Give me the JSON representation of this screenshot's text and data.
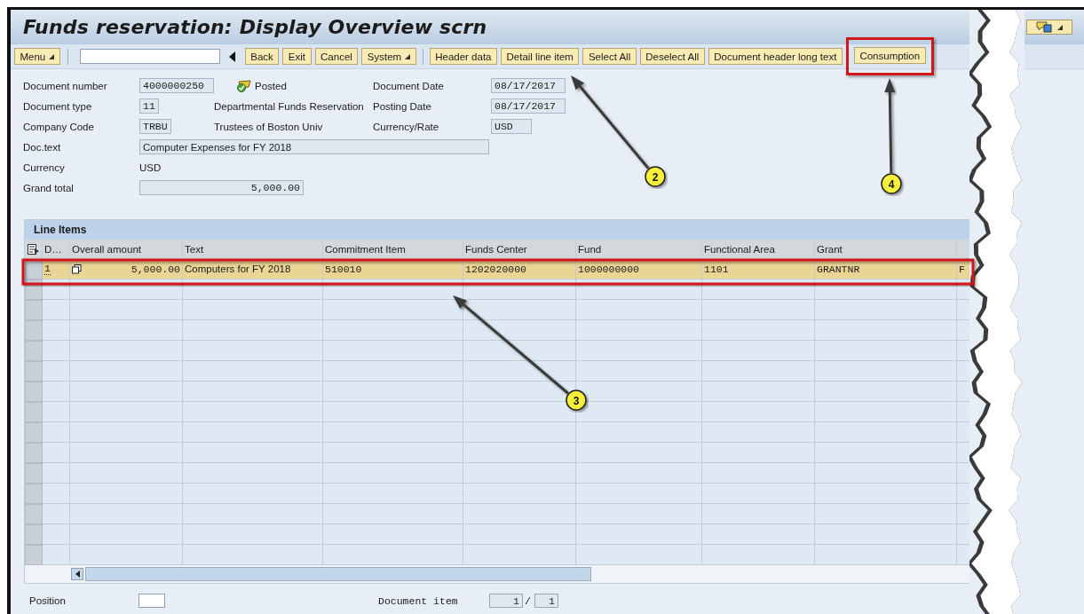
{
  "window": {
    "title": "Funds reservation: Display Overview scrn"
  },
  "toolbar": {
    "buttons": [
      {
        "label": "Menu",
        "kind": "dropdown",
        "highlighted": false
      },
      {
        "kind": "field"
      },
      {
        "kind": "back"
      },
      {
        "label": "Back",
        "kind": "button",
        "highlighted": false
      },
      {
        "label": "Exit",
        "kind": "button",
        "highlighted": false
      },
      {
        "label": "Cancel",
        "kind": "button",
        "highlighted": false
      },
      {
        "label": "System",
        "kind": "dropdown",
        "highlighted": false
      },
      {
        "kind": "separator"
      },
      {
        "label": "Header data",
        "kind": "button",
        "highlighted": false
      },
      {
        "label": "Detail line item",
        "kind": "button",
        "highlighted": false
      },
      {
        "label": "Select All",
        "kind": "button",
        "highlighted": false
      },
      {
        "label": "Deselect All",
        "kind": "button",
        "highlighted": false
      },
      {
        "label": "Document header long text",
        "kind": "button",
        "highlighted": false
      },
      {
        "label": "Consumption",
        "kind": "button",
        "highlighted": true
      }
    ]
  },
  "header": {
    "document_number": {
      "label": "Document number",
      "value": "4000000250",
      "status": "Posted"
    },
    "document_date": {
      "label": "Document Date",
      "value": "08/17/2017"
    },
    "document_type": {
      "label": "Document type",
      "value": "11",
      "description": "Departmental Funds Reservation"
    },
    "posting_date": {
      "label": "Posting Date",
      "value": "08/17/2017"
    },
    "company_code": {
      "label": "Company Code",
      "value": "TRBU",
      "description": "Trustees of Boston Univ"
    },
    "currency_rate": {
      "label": "Currency/Rate",
      "value": "USD"
    },
    "doc_text": {
      "label": "Doc.text",
      "value": "Computer Expenses for FY 2018"
    },
    "currency": {
      "label": "Currency",
      "value": "USD"
    },
    "grand_total": {
      "label": "Grand total",
      "value": "5,000.00"
    }
  },
  "line_items": {
    "title": "Line Items",
    "columns": [
      "D…",
      "Overall amount",
      "Text",
      "Commitment Item",
      "Funds Center",
      "Fund",
      "Functional Area",
      "Grant"
    ],
    "rows": [
      {
        "selected": true,
        "cells": [
          "1",
          "5,000.00",
          "Computers for FY 2018",
          "510010",
          "1202020000",
          "1000000000",
          "1101",
          "GRANTNR",
          "F"
        ]
      }
    ]
  },
  "footer": {
    "position": {
      "label": "Position"
    },
    "document_item": {
      "label": "Document item",
      "current": "1",
      "separator": "/",
      "total": "1"
    }
  },
  "callouts": [
    {
      "number": "2"
    },
    {
      "number": "3"
    },
    {
      "number": "4"
    }
  ]
}
